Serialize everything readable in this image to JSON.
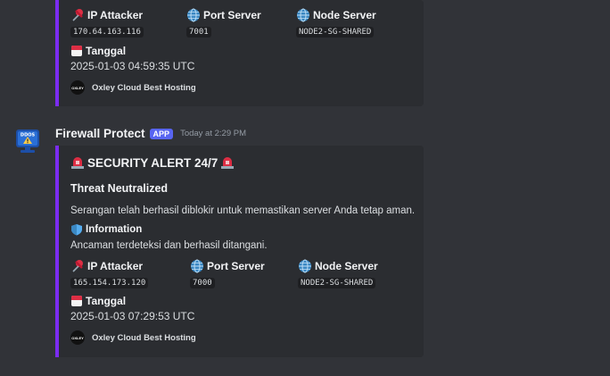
{
  "top_embed": {
    "fields": [
      {
        "label": "IP Attacker",
        "value": "170.64.163.116",
        "icon": "pushpin-icon"
      },
      {
        "label": "Port Server",
        "value": "7001",
        "icon": "globe-icon"
      },
      {
        "label": "Node Server",
        "value": "NODE2-SG-SHARED",
        "icon": "globe-icon"
      }
    ],
    "date_label": "Tanggal",
    "date_value": "2025-01-03 04:59:35 UTC",
    "footer": {
      "icon_text": "OXLEY",
      "text": "Oxley Cloud Best Hosting"
    }
  },
  "message": {
    "author": "Firewall Protect",
    "badge": "APP",
    "timestamp": "Today at 2:29 PM",
    "avatar_text": "DDOS"
  },
  "bottom_embed": {
    "title": "SECURITY ALERT 24/7",
    "subtitle": "Threat Neutralized",
    "description": "Serangan telah berhasil diblokir untuk memastikan server Anda tetap aman.",
    "info_title": "Information",
    "info_text": "Ancaman terdeteksi dan berhasil ditangani.",
    "fields": [
      {
        "label": "IP Attacker",
        "value": "165.154.173.120",
        "icon": "pushpin-icon"
      },
      {
        "label": "Port Server",
        "value": "7000",
        "icon": "globe-icon"
      },
      {
        "label": "Node Server",
        "value": "NODE2-SG-SHARED",
        "icon": "globe-icon"
      }
    ],
    "date_label": "Tanggal",
    "date_value": "2025-01-03 07:29:53 UTC",
    "footer": {
      "icon_text": "OXLEY",
      "text": "Oxley Cloud Best Hosting"
    }
  },
  "colors": {
    "background": "#313338",
    "embed_background": "#2b2d31",
    "embed_accent": "#7b2cf0",
    "app_badge": "#5865f2"
  }
}
